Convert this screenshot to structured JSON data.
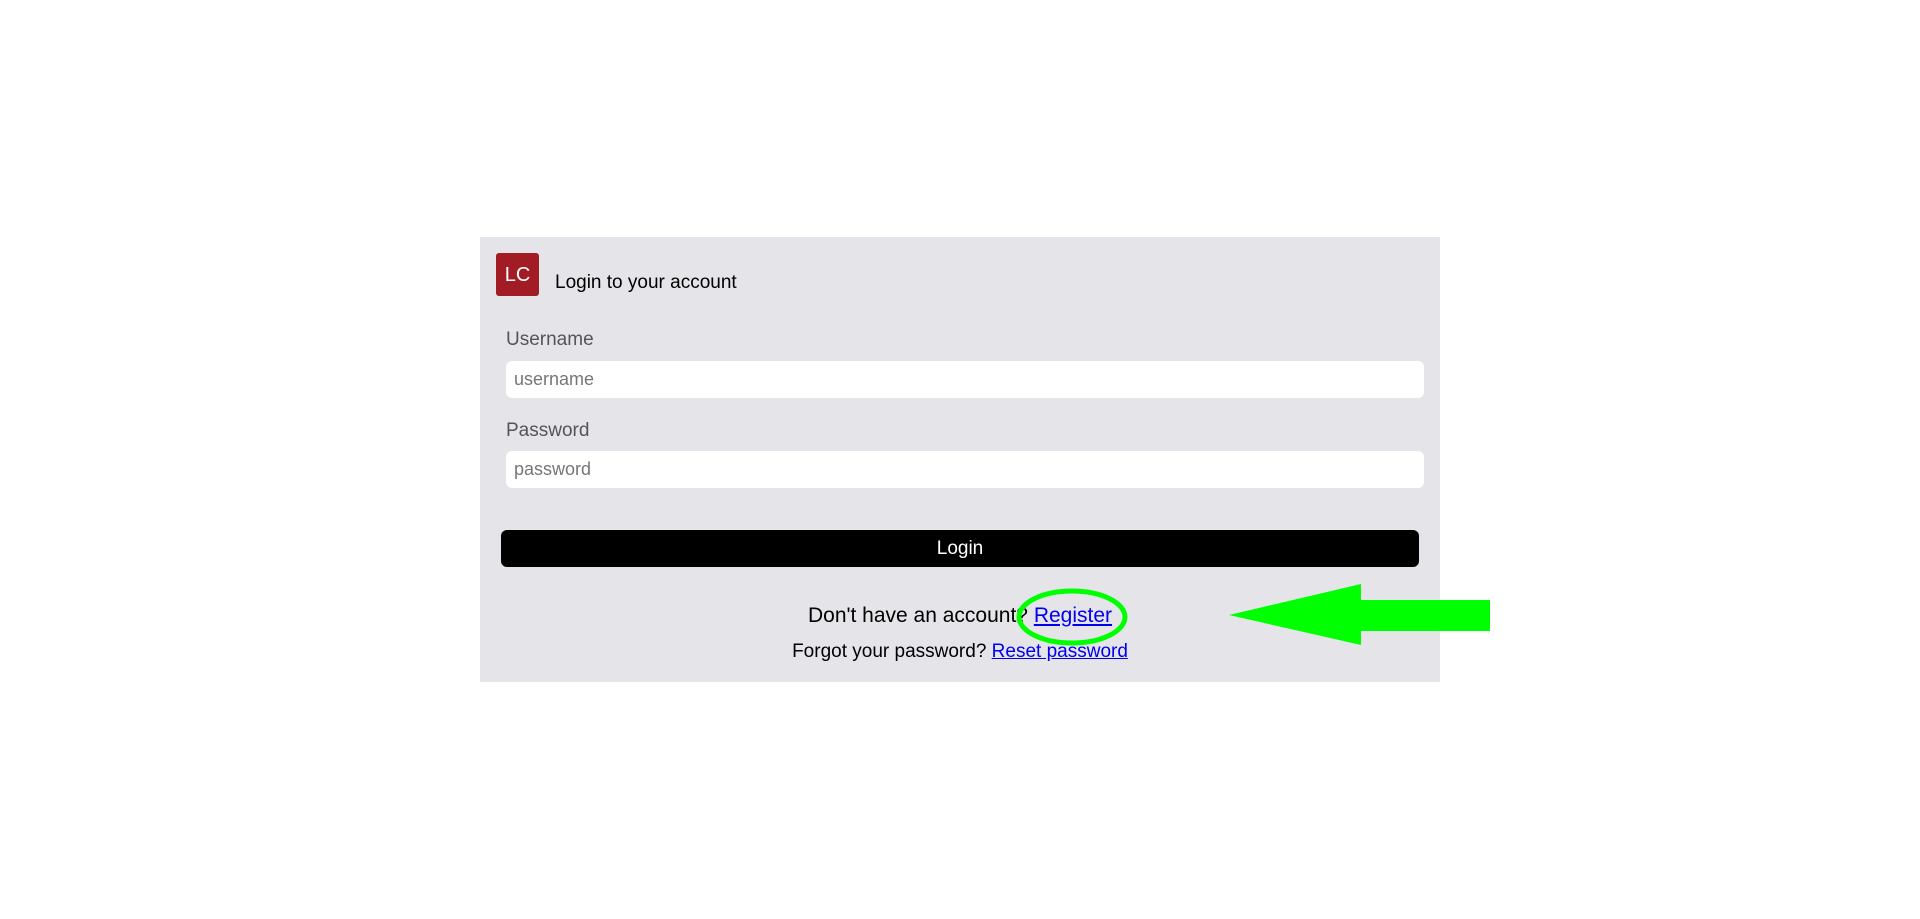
{
  "card": {
    "logo_text": "LC",
    "logo_color": "#a11c24",
    "title": "Login to your account"
  },
  "form": {
    "username_label": "Username",
    "username_placeholder": "username",
    "username_value": "",
    "password_label": "Password",
    "password_placeholder": "password",
    "password_value": "",
    "login_label": "Login"
  },
  "footer": {
    "register_prompt": "Don't have an account? ",
    "register_link": "Register",
    "reset_prompt": "Forgot your password? ",
    "reset_link": "Reset password"
  },
  "annotation": {
    "color": "#00ff00",
    "shapes": [
      "highlight-ellipse",
      "arrow-left"
    ]
  }
}
